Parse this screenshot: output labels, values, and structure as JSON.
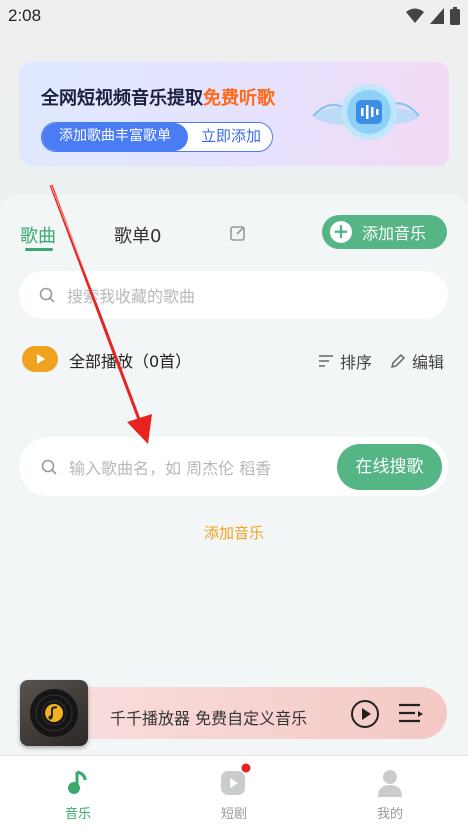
{
  "status": {
    "time": "2:08"
  },
  "banner": {
    "title_main": "全网短视频音乐提取",
    "title_highlight": "免费听歌",
    "pill_left": "添加歌曲丰富歌单",
    "pill_right": "立即添加"
  },
  "tabs": [
    {
      "label": "歌曲",
      "active": true
    },
    {
      "label": "歌单0",
      "active": false
    }
  ],
  "add_music_button": "添加音乐",
  "search": {
    "placeholder": "搜索我收藏的歌曲"
  },
  "play_all": {
    "label": "全部播放（0首）"
  },
  "sort_label": "排序",
  "edit_label": "编辑",
  "online_search": {
    "placeholder": "输入歌曲名，如 周杰伦 稻香",
    "button": "在线搜歌"
  },
  "add_music_link": "添加音乐",
  "player": {
    "title": "千千播放器 免费自定义音乐"
  },
  "nav": [
    {
      "label": "音乐",
      "icon": "music-note-icon",
      "active": true
    },
    {
      "label": "短剧",
      "icon": "play-icon",
      "active": false
    },
    {
      "label": "我的",
      "icon": "profile-icon",
      "active": false
    }
  ],
  "colors": {
    "accent_green": "#55b585",
    "accent_orange": "#f0a31e",
    "banner_blue": "#4a7cf4",
    "annotation_red": "#e8231e"
  }
}
